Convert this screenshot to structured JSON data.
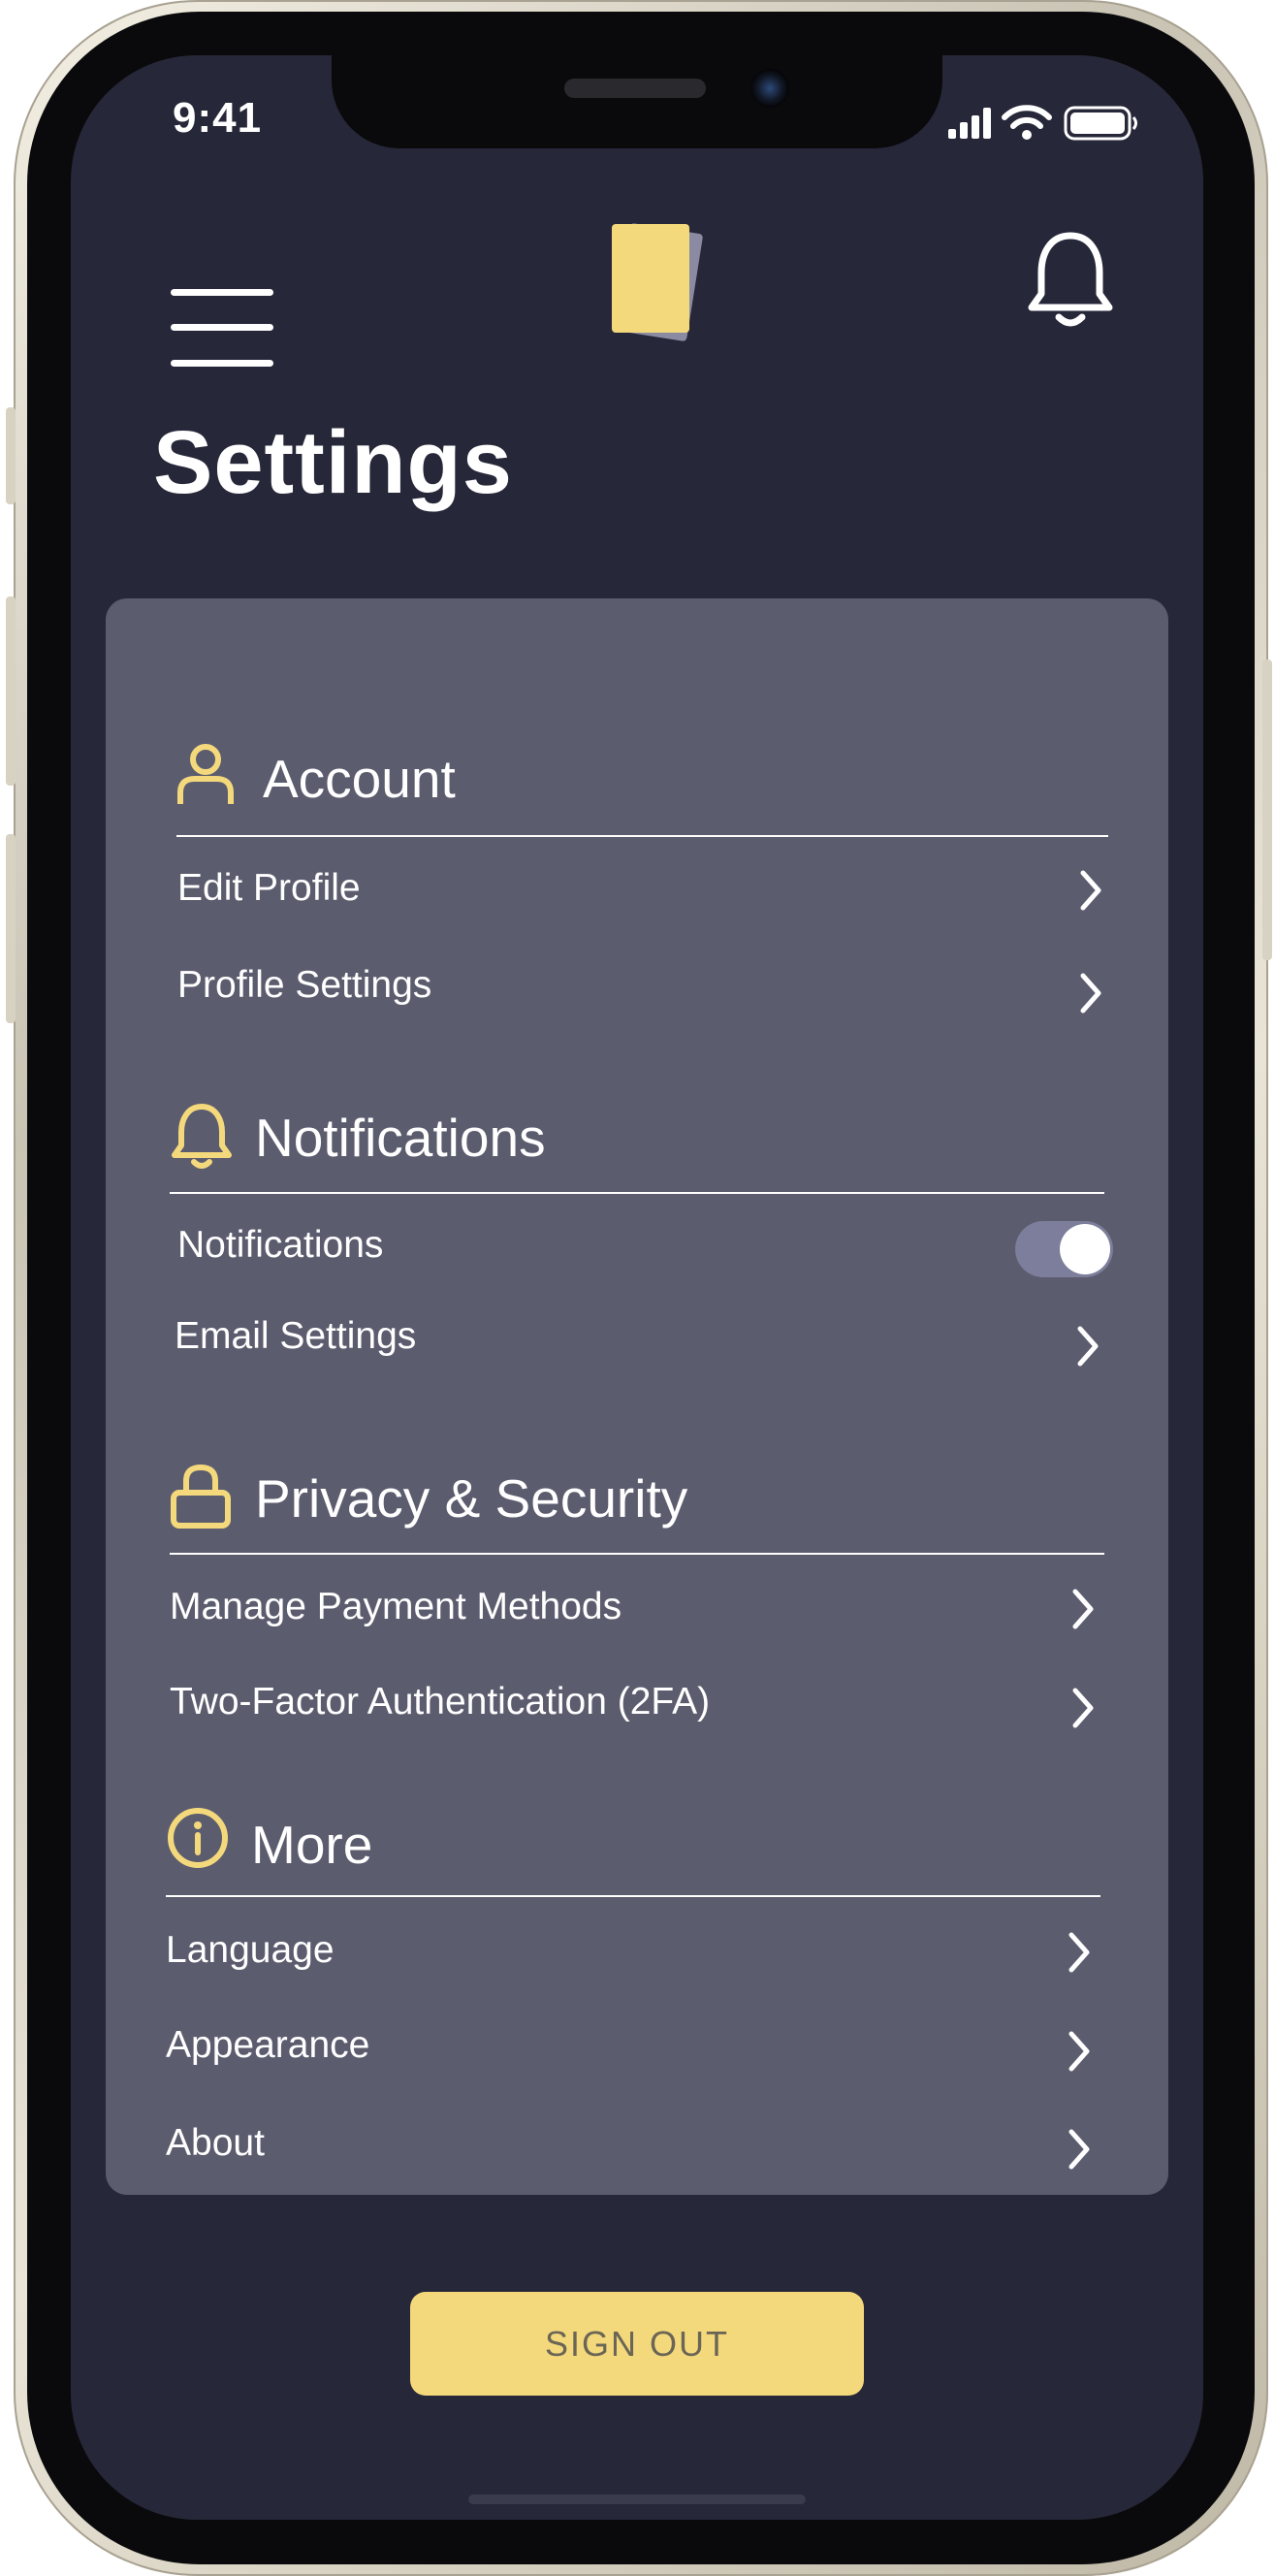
{
  "status_bar": {
    "time": "9:41"
  },
  "header": {
    "logo_colors": {
      "front": "#f4d97c",
      "back": "#8a8aa3"
    }
  },
  "page": {
    "title": "Settings"
  },
  "colors": {
    "background": "#262738",
    "card": "#5c5c6f",
    "accent": "#f4d97c",
    "toggle_track": "#7c7e9b"
  },
  "sections": {
    "account": {
      "title": "Account",
      "icon": "user-icon",
      "items": [
        {
          "label": "Edit Profile"
        },
        {
          "label": "Profile Settings"
        }
      ]
    },
    "notifications": {
      "title": "Notifications",
      "icon": "bell-icon",
      "items": [
        {
          "label": "Notifications",
          "toggle_on": true
        },
        {
          "label": "Email Settings"
        }
      ]
    },
    "privacy": {
      "title": "Privacy & Security",
      "icon": "lock-icon",
      "items": [
        {
          "label": "Manage Payment Methods"
        },
        {
          "label": "Two-Factor Authentication (2FA)"
        }
      ]
    },
    "more": {
      "title": "More",
      "icon": "info-icon",
      "items": [
        {
          "label": "Language"
        },
        {
          "label": "Appearance"
        },
        {
          "label": "About"
        }
      ]
    }
  },
  "signout": {
    "label": "SIGN OUT"
  }
}
